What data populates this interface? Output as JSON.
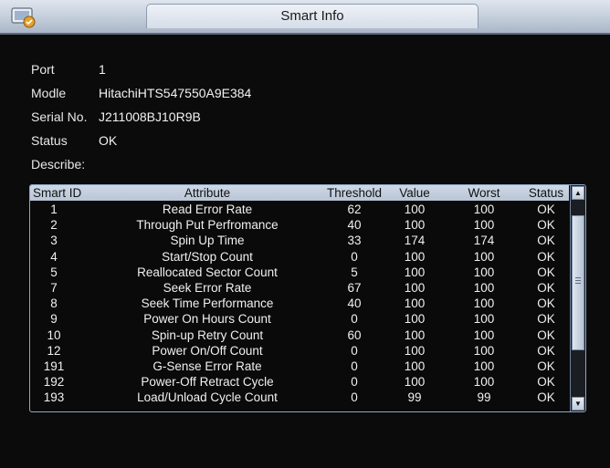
{
  "window": {
    "title": "Smart Info",
    "icon": "hard-disk-icon"
  },
  "info": {
    "port_label": "Port",
    "port_value": "1",
    "model_label": "Modle",
    "model_value": "HitachiHTS547550A9E384",
    "serial_label": "Serial No.",
    "serial_value": "J211008BJ10R9B",
    "status_label": "Status",
    "status_value": "OK",
    "describe_label": "Describe:"
  },
  "table": {
    "headers": [
      "Smart ID",
      "Attribute",
      "Threshold",
      "Value",
      "Worst",
      "Status"
    ],
    "rows": [
      [
        "1",
        "Read Error Rate",
        "62",
        "100",
        "100",
        "OK"
      ],
      [
        "2",
        "Through Put Perfromance",
        "40",
        "100",
        "100",
        "OK"
      ],
      [
        "3",
        "Spin Up Time",
        "33",
        "174",
        "174",
        "OK"
      ],
      [
        "4",
        "Start/Stop Count",
        "0",
        "100",
        "100",
        "OK"
      ],
      [
        "5",
        "Reallocated Sector Count",
        "5",
        "100",
        "100",
        "OK"
      ],
      [
        "7",
        "Seek Error Rate",
        "67",
        "100",
        "100",
        "OK"
      ],
      [
        "8",
        "Seek Time Performance",
        "40",
        "100",
        "100",
        "OK"
      ],
      [
        "9",
        "Power On Hours Count",
        "0",
        "100",
        "100",
        "OK"
      ],
      [
        "10",
        "Spin-up Retry Count",
        "60",
        "100",
        "100",
        "OK"
      ],
      [
        "12",
        "Power On/Off Count",
        "0",
        "100",
        "100",
        "OK"
      ],
      [
        "191",
        "G-Sense Error Rate",
        "0",
        "100",
        "100",
        "OK"
      ],
      [
        "192",
        "Power-Off Retract Cycle",
        "0",
        "100",
        "100",
        "OK"
      ],
      [
        "193",
        "Load/Unload Cycle Count",
        "0",
        "99",
        "99",
        "OK"
      ]
    ]
  },
  "scrollbar": {
    "up_icon": "scroll-up-icon",
    "down_icon": "scroll-down-icon",
    "up_glyph": "▲",
    "down_glyph": "▼"
  }
}
